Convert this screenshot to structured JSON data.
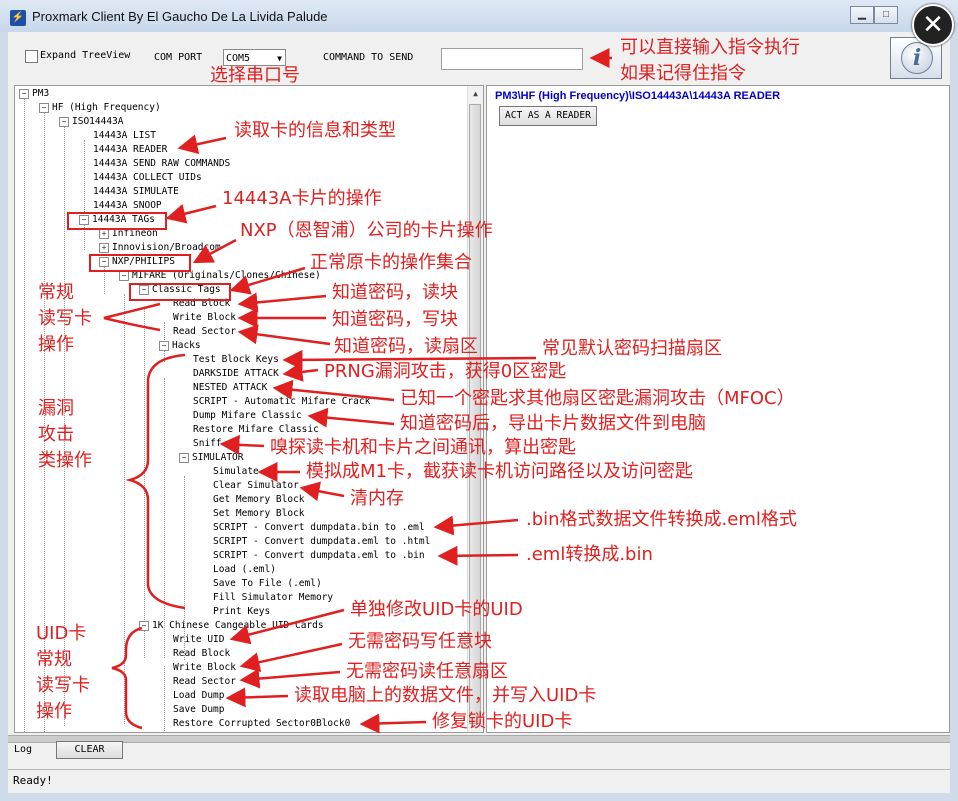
{
  "window": {
    "title": "Proxmark Client By El Gaucho De La Livida Palude"
  },
  "toolbar": {
    "expand_label": "Expand TreeView",
    "com_port_label": "COM PORT",
    "com_port_value": "COM5",
    "command_label": "COMMAND TO SEND"
  },
  "tree": {
    "root": "PM3",
    "hf": "HF (High Frequency)",
    "iso": "ISO14443A",
    "list": "14443A LIST",
    "reader": "14443A READER",
    "raw": "14443A SEND RAW COMMANDS",
    "collect": "14443A COLLECT UIDs",
    "simulate": "14443A SIMULATE",
    "snoop": "14443A SNOOP",
    "tags": "14443A TAGs",
    "infineon": "Infineon",
    "innovision": "Innovision/Broadcom",
    "nxp": "NXP/PHILIPS",
    "mifare": "MIFARE (Originals/Clones/Chinese)",
    "classic": "Classic Tags",
    "read_block": "Read Block",
    "write_block": "Write Block",
    "read_sector": "Read Sector",
    "hacks": "Hacks",
    "test_keys": "Test Block Keys",
    "darkside": "DARKSIDE ATTACK",
    "nested": "NESTED ATTACK",
    "script_crack": "SCRIPT - Automatic Mifare Crack",
    "dump": "Dump Mifare Classic",
    "restore": "Restore Mifare Classic",
    "sniff": "Sniff",
    "simulator": "SIMULATOR",
    "sim_simulate": "Simulate",
    "clear_sim": "Clear Simulator",
    "get_mem": "Get Memory Block",
    "set_mem": "Set Memory Block",
    "script_bin_eml": "SCRIPT - Convert dumpdata.bin to .eml",
    "script_eml_html": "SCRIPT - Convert dumpdata.eml to .html",
    "script_eml_bin": "SCRIPT - Convert dumpdata.eml to .bin",
    "load_eml": "Load (.eml)",
    "save_file": "Save To File (.eml)",
    "fill_mem": "Fill Simulator Memory",
    "print_keys": "Print Keys",
    "chinese": "1K Chinese Cangeable UID Cards",
    "write_uid": "Write UID",
    "c_read_block": "Read Block",
    "c_write_block": "Write Block",
    "c_read_sector": "Read Sector",
    "load_dump": "Load Dump",
    "save_dump": "Save Dump",
    "restore_corrupted": "Restore Corrupted Sector0Block0"
  },
  "right": {
    "path": "PM3\\HF (High Frequency)\\ISO14443A\\14443A READER",
    "act_button": "ACT AS A READER"
  },
  "log": {
    "label": "Log",
    "clear_button": "CLEAR"
  },
  "status": {
    "text": "Ready!"
  },
  "annotations": {
    "cmd1": "可以直接输入指令执行",
    "cmd2": "如果记得住指令",
    "com": "选择串口号",
    "read_info": "读取卡的信息和类型",
    "ops14443": "14443A卡片的操作",
    "nxp": "NXP（恩智浦）公司的卡片操作",
    "normal_set": "正常原卡的操作集合",
    "rw1": "常规",
    "rw2": "读写卡",
    "rw3": "操作",
    "know_read": "知道密码，读块",
    "know_write": "知道密码，写块",
    "know_sector": "知道密码，读扇区",
    "default_scan": "常见默认密码扫描扇区",
    "prng": "PRNG漏洞攻击，获得0区密匙",
    "mfoc": "已知一个密匙求其他扇区密匙漏洞攻击（MFOC）",
    "export": "知道密码后，导出卡片数据文件到电脑",
    "sniff": "嗅探读卡机和卡片之间通讯，算出密匙",
    "vul1": "漏洞",
    "vul2": "攻击",
    "vul3": "类操作",
    "simulate_m1": "模拟成M1卡，截获读卡机访问路径以及访问密匙",
    "clear_mem": "清内存",
    "bin_eml": ".bin格式数据文件转换成.eml格式",
    "eml_bin": ".eml转换成.bin",
    "uid_edit": "单独修改UID卡的UID",
    "uid1": "UID卡",
    "uid2": "常规",
    "uid3": "读写卡",
    "uid4": "操作",
    "nopw_block": "无需密码写任意块",
    "nopw_sector": "无需密码读任意扇区",
    "load_write": "读取电脑上的数据文件，并写入UID卡",
    "fix_uid": "修复锁卡的UID卡"
  }
}
